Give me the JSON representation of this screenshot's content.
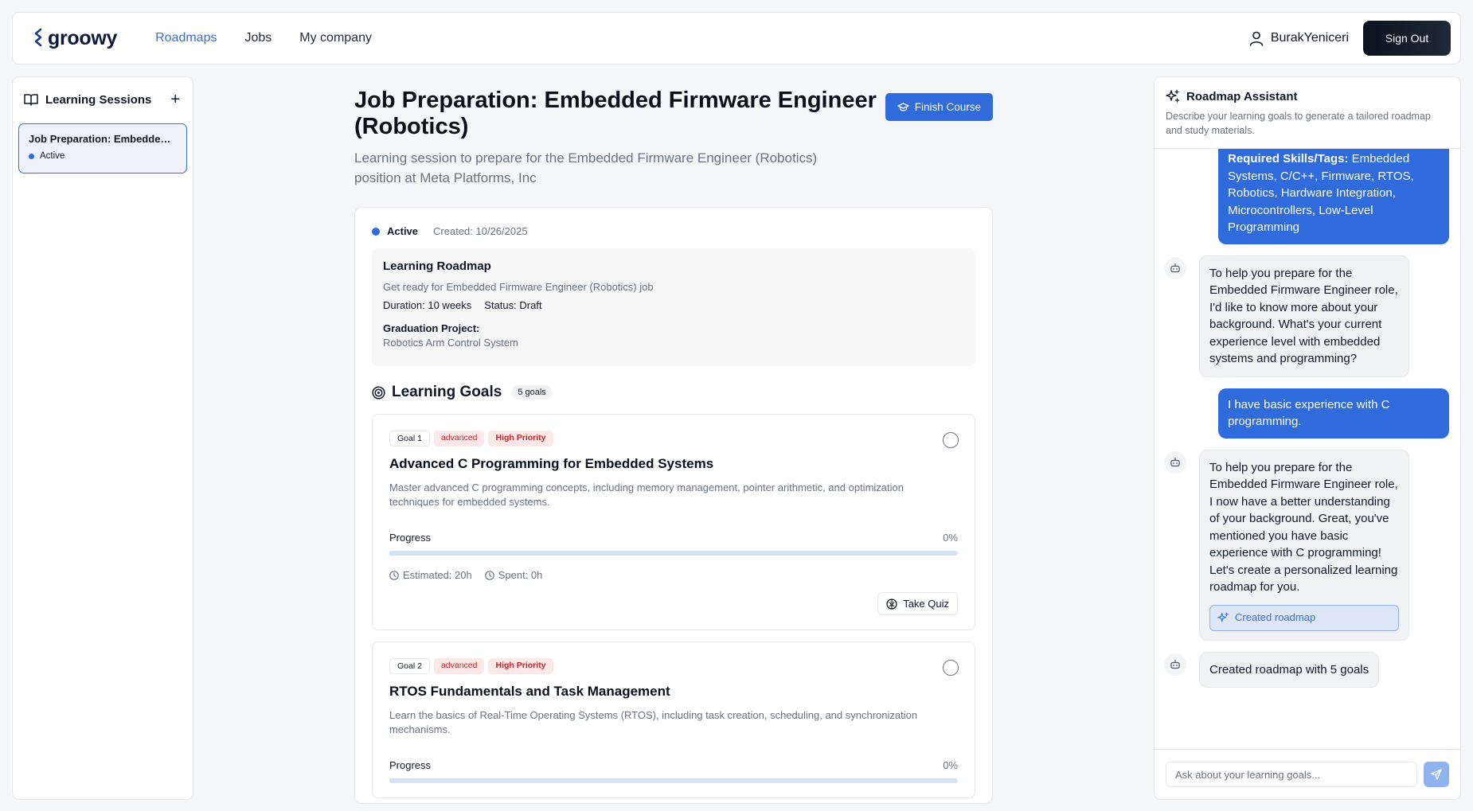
{
  "header": {
    "logo_text": "groowy",
    "nav": [
      {
        "label": "Roadmaps",
        "active": true
      },
      {
        "label": "Jobs",
        "active": false
      },
      {
        "label": "My company",
        "active": false
      }
    ],
    "username": "BurakYeniceri",
    "signout_label": "Sign Out"
  },
  "sidebar": {
    "title": "Learning Sessions",
    "add_label": "+",
    "sessions": [
      {
        "name": "Job Preparation: Embedded Firmware Engineer (Robotics)",
        "status": "Active"
      }
    ]
  },
  "main": {
    "title": "Job Preparation: Embedded Firmware Engineer (Robotics)",
    "finish_label": "Finish Course",
    "subtitle": "Learning session to prepare for the Embedded Firmware Engineer (Robotics) position at Meta Platforms, Inc",
    "status": "Active",
    "created": "Created: 10/26/2025",
    "roadmap": {
      "title": "Learning Roadmap",
      "description": "Get ready for Embedded Firmware Engineer (Robotics) job",
      "duration": "Duration: 10 weeks",
      "status": "Status: Draft",
      "grad_label": "Graduation Project:",
      "grad_value": "Robotics Arm Control System"
    },
    "goals_title": "Learning Goals",
    "goals_count": "5 goals",
    "goals": [
      {
        "num": "Goal 1",
        "level": "advanced",
        "priority": "High Priority",
        "title": "Advanced C Programming for Embedded Systems",
        "description": "Master advanced C programming concepts, including memory management, pointer arithmetic, and optimization techniques for embedded systems.",
        "progress_label": "Progress",
        "progress_value": "0%",
        "progress": 0,
        "estimated": "Estimated: 20h",
        "spent": "Spent: 0h",
        "quiz_label": "Take Quiz"
      },
      {
        "num": "Goal 2",
        "level": "advanced",
        "priority": "High Priority",
        "title": "RTOS Fundamentals and Task Management",
        "description": "Learn the basics of Real-Time Operating Systems (RTOS), including task creation, scheduling, and synchronization mechanisms.",
        "progress_label": "Progress",
        "progress_value": "0%",
        "progress": 0
      }
    ]
  },
  "assistant": {
    "title": "Roadmap Assistant",
    "description": "Describe your learning goals to generate a tailored roadmap and study materials.",
    "messages": [
      {
        "role": "user",
        "bold": "Required Skills/Tags:",
        "text": " Embedded Systems, C/C++, Firmware, RTOS, Robotics, Hardware Integration, Microcontrollers, Low-Level Programming"
      },
      {
        "role": "bot",
        "text": "To help you prepare for the Embedded Firmware Engineer role, I'd like to know more about your background. What's your current experience level with embedded systems and programming?"
      },
      {
        "role": "user",
        "text": "I have basic experience with C programming."
      },
      {
        "role": "bot",
        "text": "To help you prepare for the Embedded Firmware Engineer role, I now have a better understanding of your background. Great, you've mentioned you have basic experience with C programming! Let's create a personalized learning roadmap for you.",
        "chip": "Created roadmap"
      },
      {
        "role": "bot",
        "text": "Created roadmap with 5 goals"
      }
    ],
    "input_placeholder": "Ask about your learning goals..."
  },
  "colors": {
    "accent": "#2f6bdb",
    "link_active": "#3b6fd8",
    "priority_bg": "#fde8e8",
    "priority_text": "#c0262d"
  }
}
